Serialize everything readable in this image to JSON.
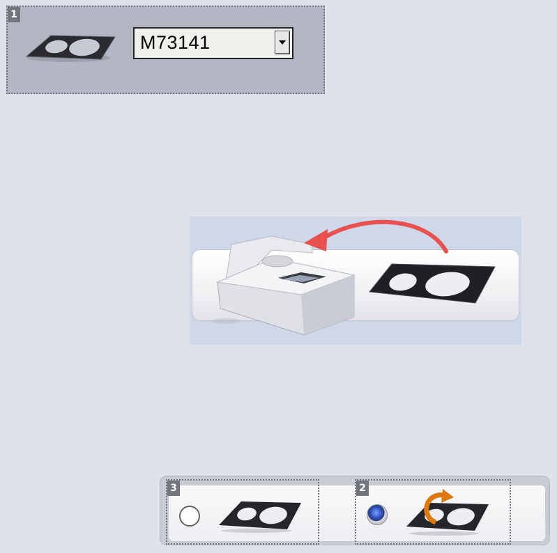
{
  "step1": {
    "badge": "1",
    "tray_icon": "tray-icon",
    "dropdown": {
      "selected": "M73141",
      "arrow_icon": "chevron-down-icon"
    }
  },
  "illustration": {
    "scanner_icon": "scanner-icon",
    "arrow_icon": "curved-arrow-icon",
    "tray_icon": "tray-icon",
    "arrow_color": "#e8514d"
  },
  "options": [
    {
      "badge": "3",
      "selected": false,
      "icon": "tray-icon"
    },
    {
      "badge": "2",
      "selected": true,
      "icon": "rotated-tray-icon",
      "rotate_color": "#e07810"
    }
  ]
}
